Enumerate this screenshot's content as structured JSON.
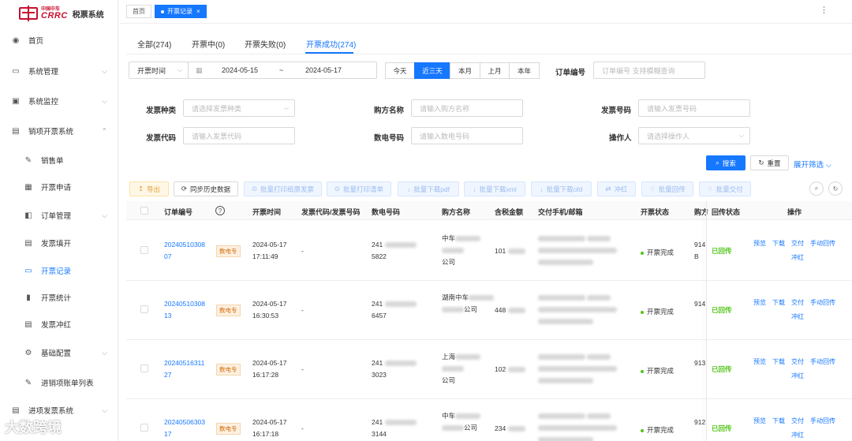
{
  "brand": {
    "cn": "中国中车",
    "en": "CRRC",
    "system": "税票系统"
  },
  "sidebar": {
    "items": [
      {
        "label": "首页",
        "icon": "dashboard-icon",
        "glyph": "◉"
      },
      {
        "label": "系统管理",
        "icon": "monitor-icon",
        "glyph": "▭"
      },
      {
        "label": "系统监控",
        "icon": "screen-icon",
        "glyph": "▣"
      },
      {
        "label": "销项开票系统",
        "icon": "document-icon",
        "glyph": "▤"
      },
      {
        "label": "销售单",
        "icon": "edit-icon",
        "glyph": "✎"
      },
      {
        "label": "开票申请",
        "icon": "grid-icon",
        "glyph": "▦"
      },
      {
        "label": "订单管理",
        "icon": "folder-icon",
        "glyph": "◧"
      },
      {
        "label": "发票填开",
        "icon": "file-icon",
        "glyph": "▤"
      },
      {
        "label": "开票记录",
        "icon": "record-icon",
        "glyph": "▭"
      },
      {
        "label": "开票统计",
        "icon": "bar-chart-icon",
        "glyph": "▮"
      },
      {
        "label": "发票冲红",
        "icon": "invoice-icon",
        "glyph": "▤"
      },
      {
        "label": "基础配置",
        "icon": "gear-icon",
        "glyph": "⚙"
      },
      {
        "label": "进销项账单列表",
        "icon": "list-icon",
        "glyph": "✎"
      },
      {
        "label": "进项发票系统",
        "icon": "document-icon",
        "glyph": "▤"
      }
    ]
  },
  "tabs": {
    "home": "首页",
    "current": "开票记录"
  },
  "status_tabs": [
    "全部(274)",
    "开票中(0)",
    "开票失败(0)",
    "开票成功(274)"
  ],
  "filters": {
    "time_type": "开票时间",
    "date_start": "2024-05-15",
    "date_sep": "~",
    "date_end": "2024-05-17",
    "quick": [
      "今天",
      "近三天",
      "本月",
      "上月",
      "本年"
    ],
    "order_no_label": "订单编号",
    "order_no_placeholder": "订单编号 支持模糊查询",
    "invoice_type_label": "发票种类",
    "invoice_type_placeholder": "请选择发票种类",
    "buyer_label": "购方名称",
    "buyer_placeholder": "请输入购方名称",
    "invoice_no_label": "发票号码",
    "invoice_no_placeholder": "请输入发票号码",
    "invoice_code_label": "发票代码",
    "invoice_code_placeholder": "请输入发票代码",
    "digital_no_label": "数电号码",
    "digital_no_placeholder": "请输入数电号码",
    "operator_label": "操作人",
    "operator_placeholder": "请选择操作人",
    "search": "搜索",
    "reset": "重置",
    "expand": "展开筛选"
  },
  "toolbar": [
    "导出",
    "同步历史数据",
    "批量打印纸质发票",
    "批量打印清单",
    "批量下载pdf",
    "批量下载xml",
    "批量下载ofd",
    "冲红",
    "批量回传",
    "批量交付"
  ],
  "table": {
    "headers": [
      "订单编号",
      "开票时间",
      "发票代码/发票号码",
      "数电号码",
      "购方名称",
      "含税金额",
      "交付手机/邮箱",
      "开票状态",
      "购方",
      "回传状态",
      "操作"
    ],
    "rows": [
      {
        "order1": "20240510308",
        "order2": "07",
        "badge": "数电专",
        "date": "2024-05-17",
        "time": "17:11:49",
        "code": "-",
        "dn1": "241",
        "dn2": "5822",
        "buyer1": "中车",
        "buyer2": "",
        "buyer3": "公司",
        "amount": "101",
        "status": "开票完成",
        "tax1": "914",
        "tax2": "B",
        "returned": "已回传",
        "ops": [
          "预览",
          "下载",
          "交付",
          "手动回传"
        ],
        "ops2": "冲红"
      },
      {
        "order1": "20240510308",
        "order2": "13",
        "badge": "数电专",
        "date": "2024-05-17",
        "time": "16:30:53",
        "code": "-",
        "dn1": "241",
        "dn2": "6457",
        "buyer1": "湖南中车",
        "buyer2": "公司",
        "buyer3": "",
        "amount": "448",
        "status": "开票完成",
        "tax1": "914",
        "tax2": "",
        "returned": "已回传",
        "ops": [
          "预览",
          "下载",
          "交付",
          "手动回传"
        ],
        "ops2": "冲红"
      },
      {
        "order1": "20240516311",
        "order2": "27",
        "badge": "数电专",
        "date": "2024-05-17",
        "time": "16:17:28",
        "code": "-",
        "dn1": "241",
        "dn2": "3023",
        "buyer1": "上海",
        "buyer2": "",
        "buyer3": "公司",
        "amount": "102",
        "status": "开票完成",
        "tax1": "913",
        "tax2": "",
        "returned": "已回传",
        "ops": [
          "预览",
          "下载",
          "交付",
          "手动回传"
        ],
        "ops2": "冲红"
      },
      {
        "order1": "20240506303",
        "order2": "17",
        "badge": "数电专",
        "date": "2024-05-17",
        "time": "16:17:18",
        "code": "-",
        "dn1": "241",
        "dn2": "3144",
        "buyer1": "中车",
        "buyer2": "公司",
        "buyer3": "",
        "amount": "234",
        "status": "开票完成",
        "tax1": "912",
        "tax2": "",
        "returned": "已回传",
        "ops": [
          "预览",
          "下载",
          "交付",
          "手动回传"
        ],
        "ops2": "冲红"
      }
    ]
  },
  "watermark": "大数跨境",
  "colors": {
    "primary": "#1677ff",
    "success": "#52c41a",
    "brand": "#c8102e"
  }
}
